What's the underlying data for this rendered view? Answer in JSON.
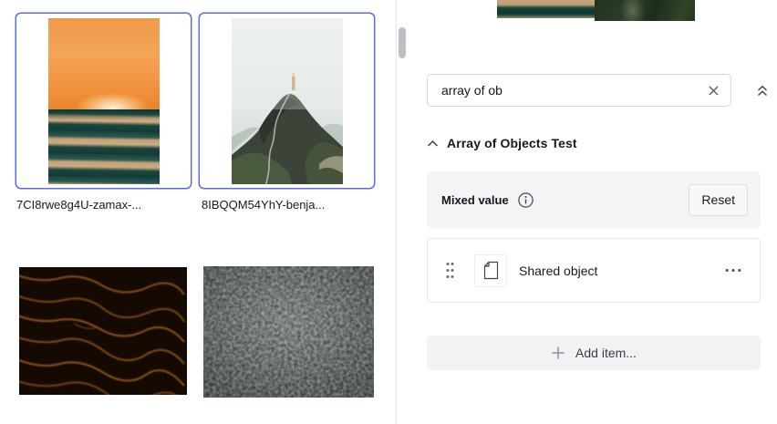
{
  "colors": {
    "selection_blue": "#5c6be8",
    "muted_bg": "#f3f4f6",
    "card_border": "#e2e4e8",
    "divider": "#e5e7ea"
  },
  "media_library": {
    "items": [
      {
        "filename": "7CI8rwe8g4U-zamax-...",
        "selected": true,
        "image": "sunset-over-ocean"
      },
      {
        "filename": "8IBQQM54YhY-benja...",
        "selected": true,
        "image": "misty-mountain-peak"
      },
      {
        "selected": false,
        "image": "dark-sand-dunes"
      },
      {
        "selected": false,
        "image": "frosted-forest-aerial"
      }
    ]
  },
  "inspector": {
    "search_value": "array of ob",
    "section_title": "Array of Objects Test",
    "mixed_value_label": "Mixed value",
    "reset_button": "Reset",
    "items": [
      {
        "title": "Shared object"
      }
    ],
    "add_item_button": "Add item..."
  },
  "icons": {
    "clear": "x-icon",
    "collapse_all": "chevron-double-up-icon",
    "section_toggle": "chevron-up-icon",
    "info": "info-circle-icon",
    "drag": "drag-handle-dots-icon",
    "document": "document-page-icon",
    "menu": "ellipsis-icon",
    "add": "plus-icon"
  }
}
